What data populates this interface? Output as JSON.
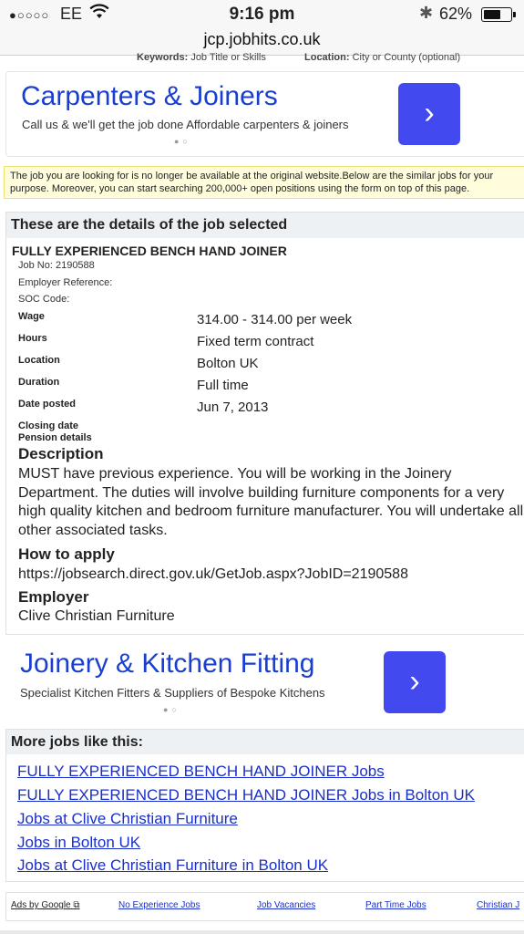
{
  "status": {
    "carrier": "EE",
    "time": "9:16 pm",
    "battery": "62%",
    "battery_level": 0.62
  },
  "browser": {
    "url": "jcp.jobhits.co.uk"
  },
  "search_form": {
    "keywords_label": "Keywords:",
    "keywords_hint": "Job Title or Skills",
    "location_label": "Location:",
    "location_hint": "City or County (optional)"
  },
  "ad_top": {
    "title": "Carpenters & Joiners",
    "subtitle": "Call us & we'll get the job done Affordable carpenters & joiners",
    "arrow": "›",
    "dots": "●○"
  },
  "notice": "The job you are looking for is no longer be available at the original website.Below are the similar jobs for your purpose. Moreover, you can start searching 200,000+ open positions using the form on top of this page.",
  "job": {
    "section_heading": "These are the details of the job selected",
    "title": "FULLY EXPERIENCED BENCH HAND JOINER",
    "job_no": "Job No:  2190588",
    "employer_reference": "Employer Reference:",
    "soc_code": "SOC Code:",
    "fields": [
      {
        "label": "Wage",
        "value": "314.00 - 314.00  per week"
      },
      {
        "label": "Hours",
        "value": "Fixed term contract"
      },
      {
        "label": "Location",
        "value": "Bolton UK"
      },
      {
        "label": "Duration",
        "value": "Full time"
      },
      {
        "label": "Date posted",
        "value": "Jun 7, 2013"
      }
    ],
    "closing_date_label": "Closing date",
    "pension_label": "Pension details",
    "description_heading": "Description",
    "description": "MUST have previous experience.  You will be working in the Joinery Department.  The duties will involve building furniture components for a very high quality kitchen and bedroom furniture manufacturer.  You will undertake all other associated tasks.",
    "apply_heading": "How to apply",
    "apply_url": "https://jobsearch.direct.gov.uk/GetJob.aspx?JobID=2190588",
    "employer_heading": "Employer",
    "employer": "Clive Christian Furniture"
  },
  "ad_bottom": {
    "title": "Joinery & Kitchen Fitting",
    "subtitle": "Specialist Kitchen Fitters & Suppliers of Bespoke Kitchens",
    "arrow": "›",
    "dots": "●○"
  },
  "more_jobs": {
    "heading": "More jobs like this:",
    "links": [
      "FULLY EXPERIENCED BENCH HAND JOINER Jobs",
      "FULLY EXPERIENCED BENCH HAND JOINER Jobs in Bolton UK",
      "Jobs at Clive Christian Furniture",
      "Jobs in Bolton UK",
      "Jobs at Clive Christian Furniture in Bolton UK"
    ]
  },
  "footer": {
    "ads_by_google": "Ads by Google",
    "links": [
      "No Experience Jobs",
      "Job Vacancies",
      "Part Time Jobs",
      "Christian J"
    ]
  },
  "colors": {
    "ad_title": "#1a3fcf",
    "ad_button": "#4149ef",
    "link": "#1a2fc9",
    "notice_bg": "#fffddb",
    "section_header_bg": "#eef1f4"
  }
}
